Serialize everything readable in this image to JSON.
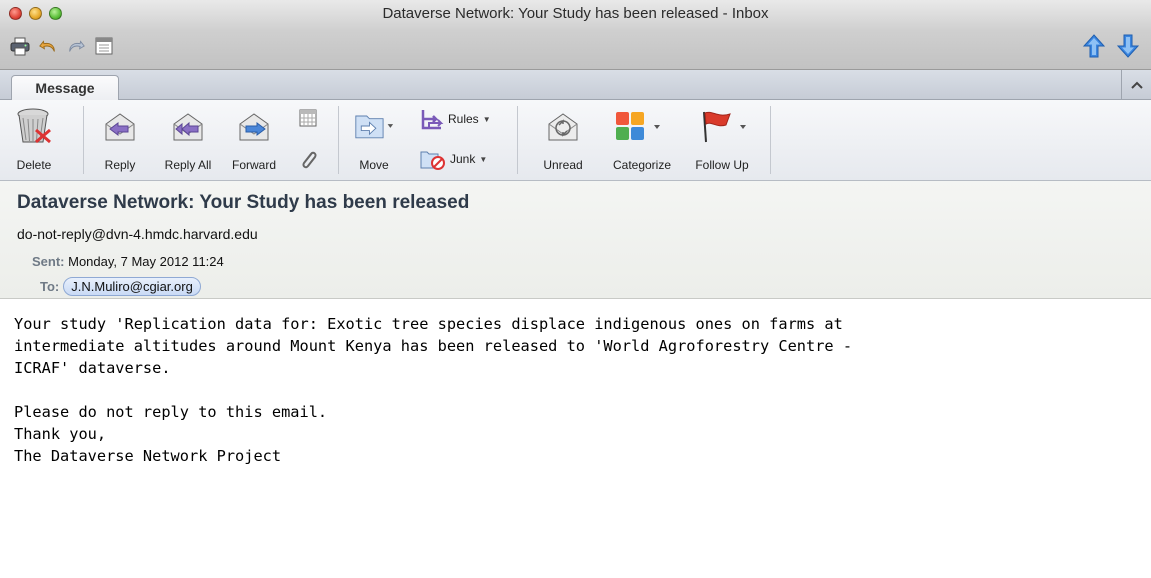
{
  "window": {
    "title": "Dataverse Network: Your Study has been released - Inbox"
  },
  "quick_toolbar": {
    "icons": [
      "printer-icon",
      "undo-icon",
      "redo-icon",
      "calendar-icon"
    ],
    "nav": [
      "previous-message-icon",
      "next-message-icon"
    ]
  },
  "ribbon": {
    "tab_label": "Message",
    "buttons": {
      "delete": "Delete",
      "reply": "Reply",
      "reply_all": "Reply All",
      "forward": "Forward",
      "move": "Move",
      "rules": "Rules",
      "junk": "Junk",
      "unread": "Unread",
      "categorize": "Categorize",
      "follow_up": "Follow Up"
    }
  },
  "message": {
    "subject": "Dataverse Network: Your Study has been released",
    "from": "do-not-reply@dvn-4.hmdc.harvard.edu",
    "sent_label": "Sent:",
    "sent_value": "Monday, 7 May 2012 11:24",
    "to_label": "To:",
    "to_value": "J.N.Muliro@cgiar.org",
    "body": "Your study 'Replication data for: Exotic tree species displace indigenous ones on farms at\nintermediate altitudes around Mount Kenya has been released to 'World Agroforestry Centre -\nICRAF' dataverse.\n\nPlease do not reply to this email.\nThank you,\nThe Dataverse Network Project"
  },
  "colors": {
    "subject": "#2f3b4a",
    "header_label": "#6f7a86",
    "recipient_chip": "#c9daf5",
    "nav_arrow": "#3b86e0"
  }
}
